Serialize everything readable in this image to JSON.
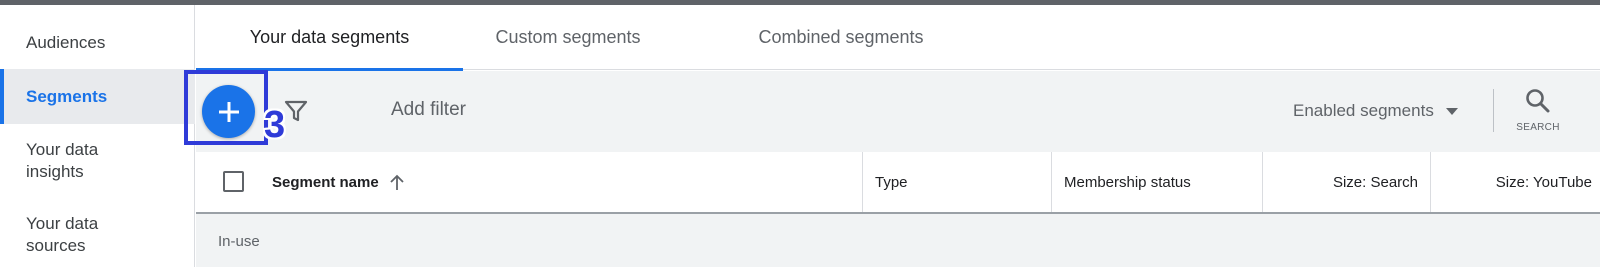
{
  "sidebar": {
    "items": [
      {
        "label": "Audiences",
        "active": false
      },
      {
        "label": "Segments",
        "active": true
      },
      {
        "label": "Your data insights",
        "active": false
      },
      {
        "label": "Your data sources",
        "active": false
      }
    ]
  },
  "tabs": [
    {
      "label": "Your data segments",
      "active": true
    },
    {
      "label": "Custom segments",
      "active": false
    },
    {
      "label": "Combined segments",
      "active": false
    }
  ],
  "toolbar": {
    "add_icon": "plus-icon",
    "step_number": "3",
    "filter_icon": "filter-icon",
    "add_filter_label": "Add filter",
    "dropdown_value": "Enabled segments",
    "search_label": "SEARCH",
    "search_icon": "search-icon"
  },
  "table": {
    "columns": [
      {
        "label": "Segment name",
        "sort": "ascending"
      },
      {
        "label": "Type"
      },
      {
        "label": "Membership status"
      },
      {
        "label": "Size: Search"
      },
      {
        "label": "Size: YouTube"
      }
    ],
    "group_label": "In-use"
  },
  "colors": {
    "accent": "#1a73e8",
    "highlight": "#2f3bd8",
    "toolbar_bg": "#f1f3f4"
  }
}
